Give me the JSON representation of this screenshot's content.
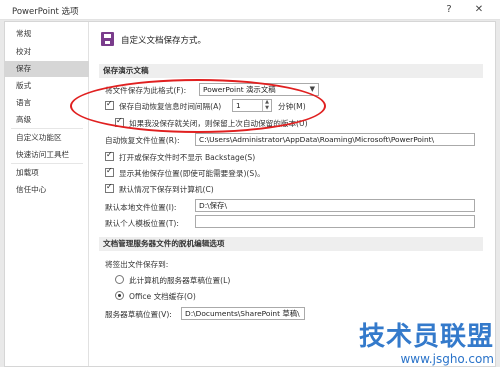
{
  "window": {
    "title": "PowerPoint 选项"
  },
  "sidebar": {
    "items": [
      {
        "label": "常规"
      },
      {
        "label": "校对"
      },
      {
        "label": "保存",
        "active": true
      },
      {
        "label": "版式"
      },
      {
        "label": "语言"
      },
      {
        "label": "高级"
      },
      {
        "label": "自定义功能区"
      },
      {
        "label": "快速访问工具栏"
      },
      {
        "label": "加载项"
      },
      {
        "label": "信任中心"
      }
    ]
  },
  "main": {
    "header": "自定义文档保存方式。",
    "section1": "保存演示文稿",
    "save_format_label": "将文件保存为此格式(F):",
    "save_format_value": "PowerPoint 演示文稿",
    "autorecover_label": "保存自动恢复信息时间间隔(A)",
    "autorecover_value": "1",
    "minutes_label": "分钟(M)",
    "keep_last_label": "如果我没保存就关闭，则保留上次自动保留的版本(U)",
    "autorecover_loc_label": "自动恢复文件位置(R):",
    "autorecover_loc_value": "C:\\Users\\Administrator\\AppData\\Roaming\\Microsoft\\PowerPoint\\",
    "no_backstage_label": "打开或保存文件时不显示 Backstage(S)",
    "show_additional_label": "显示其他保存位置(即使可能需要登录)(S)。",
    "save_to_computer_label": "默认情况下保存到计算机(C)",
    "default_local_label": "默认本地文件位置(I):",
    "default_local_value": "D:\\保存\\",
    "personal_templates_label": "默认个人模板位置(T):",
    "personal_templates_value": "",
    "section2": "文档管理服务器文件的脱机编辑选项",
    "save_checked_out_label": "将签出文件保存到:",
    "server_drafts_label": "此计算机的服务器草稿位置(L)",
    "office_cache_label": "Office 文档缓存(O)",
    "server_drafts_loc_label": "服务器草稿位置(V):",
    "server_drafts_loc_value": "D:\\Documents\\SharePoint 草稿\\",
    "watermark": "技术员联盟",
    "watermark_url": "www.jsgho.com"
  }
}
